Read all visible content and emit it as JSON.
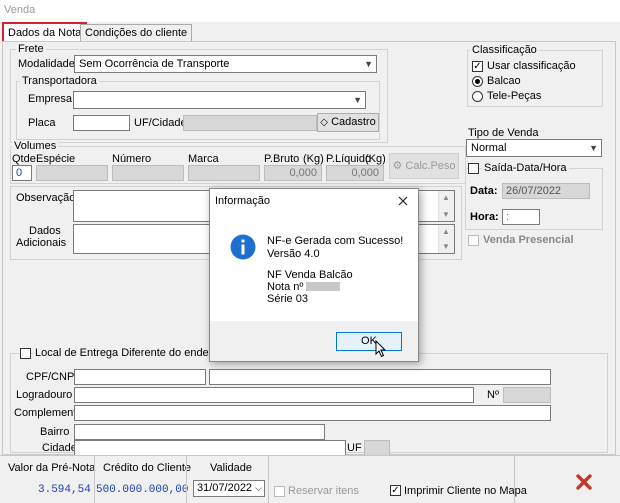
{
  "window": {
    "title": "Venda"
  },
  "tabs": [
    {
      "label": "Dados da Nota"
    },
    {
      "label": "Condições do cliente"
    }
  ],
  "frete": {
    "legend": "Frete",
    "modalidade_label": "Modalidade",
    "modalidade_value": "Sem Ocorrência de Transporte",
    "transportadora_legend": "Transportadora",
    "empresa_label": "Empresa",
    "placa_label": "Placa",
    "uf_cidade_label": "UF/Cidade",
    "cadastro_button": "Cadastro"
  },
  "volumes": {
    "legend": "Volumes",
    "headers": {
      "qtde": "Qtde",
      "especie": "Espécie",
      "numero": "Número",
      "marca": "Marca",
      "peso_bruto": "P.Bruto",
      "kg1": "(Kg)",
      "peso_liquido": "P.Líquido",
      "kg2": "(Kg)"
    },
    "qtde_value": "0",
    "peso_bruto_value": "0,000",
    "peso_liquido_value": "0,000",
    "calc_peso_button": "Calc.Peso"
  },
  "observacao_label": "Observação",
  "dados_adicionais_label_1": "Dados",
  "dados_adicionais_label_2": "Adicionais",
  "classificacao": {
    "legend": "Classificação",
    "usar_label": "Usar classificação",
    "balcao_label": "Balcao",
    "tele_label": "Tele-Peças"
  },
  "tipo_venda": {
    "label": "Tipo de Venda",
    "value": "Normal"
  },
  "saida": {
    "label": "Saída-Data/Hora",
    "data_label": "Data:",
    "data_value": "26/07/2022",
    "hora_label": "Hora:",
    "hora_value": ":"
  },
  "venda_presencial_label": "Venda Presencial",
  "local_entrega": {
    "label": "Local de Entrega Diferente do endereço de",
    "cpf_label": "CPF/CNPJ",
    "logradouro_label": "Logradouro",
    "numero_label": "Nº",
    "complemento_label": "Complemento",
    "bairro_label": "Bairro",
    "cidade_label": "Cidade",
    "uf_label": "UF"
  },
  "footer": {
    "valor_pre_nota_label": "Valor da Pré-Nota",
    "valor_pre_nota_value": "3.594,54",
    "credito_label": "Crédito do Cliente",
    "credito_value": "500.000.000,00",
    "validade_label": "Validade",
    "validade_value": "31/07/2022",
    "reservar_label": "Reservar itens",
    "imprimir_label": "Imprimir Cliente no Mapa"
  },
  "dialog": {
    "title": "Informação",
    "line1": "NF-e Gerada com Sucesso!",
    "line2": "Versão 4.0",
    "line3": "NF Venda Balcão",
    "line4": "Nota  nº",
    "line5": "Série 03",
    "ok_label": "OK"
  },
  "colors": {
    "tab_highlight": "#d9202a",
    "info_icon": "#1e6fd0",
    "close_x": "#c0392b",
    "value_blue": "#1a3fb3"
  }
}
